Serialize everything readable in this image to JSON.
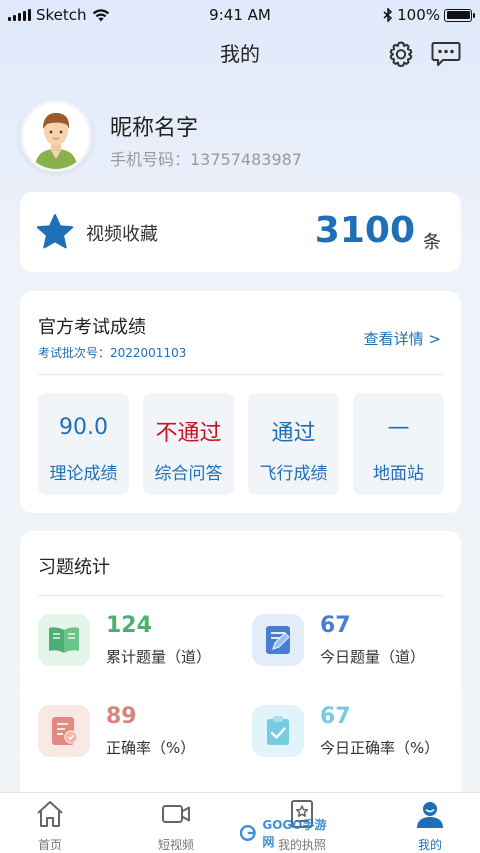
{
  "status_bar": {
    "carrier": "Sketch",
    "time": "9:41 AM",
    "battery": "100%",
    "battery_level": 1.0
  },
  "header": {
    "title": "我的"
  },
  "profile": {
    "nickname": "昵称名字",
    "phone": "手机号码：13757483987"
  },
  "favorites": {
    "label": "视频收藏",
    "count": "3100",
    "unit": "条"
  },
  "exam": {
    "title": "官方考试成绩",
    "batch": "考试批次号：2022001103",
    "detail_link": "查看详情 >",
    "scores": [
      {
        "value": "90.0",
        "label": "理论成绩",
        "color": "#1f6fb8"
      },
      {
        "value": "不通过",
        "label": "综合问答",
        "color": "#c8141e"
      },
      {
        "value": "通过",
        "label": "飞行成绩",
        "color": "#1f6fb8"
      },
      {
        "value": "—",
        "label": "地面站",
        "color": "#1f6fb8"
      }
    ]
  },
  "stats": {
    "title": "习题统计",
    "items": [
      {
        "value": "124",
        "label": "累计题量（道）",
        "color": "#4caf74",
        "icon": "book-icon"
      },
      {
        "value": "67",
        "label": "今日题量（道）",
        "color": "#4a7fd0",
        "icon": "edit-icon"
      },
      {
        "value": "89",
        "label": "正确率（%）",
        "color": "#d9847b",
        "icon": "report-icon"
      },
      {
        "value": "67",
        "label": "今日正确率（%）",
        "color": "#79cbe0",
        "icon": "checklist-icon"
      }
    ]
  },
  "tabbar": {
    "items": [
      {
        "label": "首页",
        "icon": "home-icon"
      },
      {
        "label": "短视频",
        "icon": "video-icon"
      },
      {
        "label": "我的执照",
        "icon": "license-icon"
      },
      {
        "label": "我的",
        "icon": "user-icon"
      }
    ],
    "active_color": "#1f6fb8"
  },
  "watermark": {
    "text": "GOGO手游网"
  }
}
